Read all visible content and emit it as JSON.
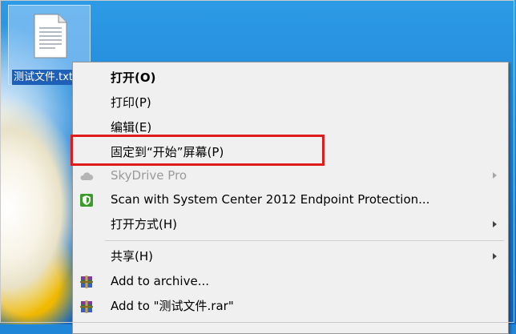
{
  "desktop_icon": {
    "label": "测试文件.txt",
    "icon": "text-file-icon"
  },
  "context_menu": {
    "items": [
      {
        "label": "打开(O)",
        "bold": true
      },
      {
        "label": "打印(P)"
      },
      {
        "label": "编辑(E)"
      },
      {
        "label": "固定到“开始”屏幕(P)"
      },
      {
        "label": "SkyDrive Pro",
        "disabled": true,
        "icon": "cloud-icon",
        "submenu": true
      },
      {
        "label": "Scan with System Center 2012 Endpoint Protection...",
        "icon": "shield-icon"
      },
      {
        "label": "打开方式(H)",
        "submenu": true
      },
      {
        "label": "共享(H)",
        "submenu": true
      },
      {
        "label": "Add to archive...",
        "icon": "winrar-icon"
      },
      {
        "label": "Add to \"测试文件.rar\"",
        "icon": "winrar-icon"
      }
    ]
  },
  "colors": {
    "highlight_box": "#e01b1b",
    "menu_background": "#f0f0f0",
    "desktop_blue": "#1f86d8"
  }
}
